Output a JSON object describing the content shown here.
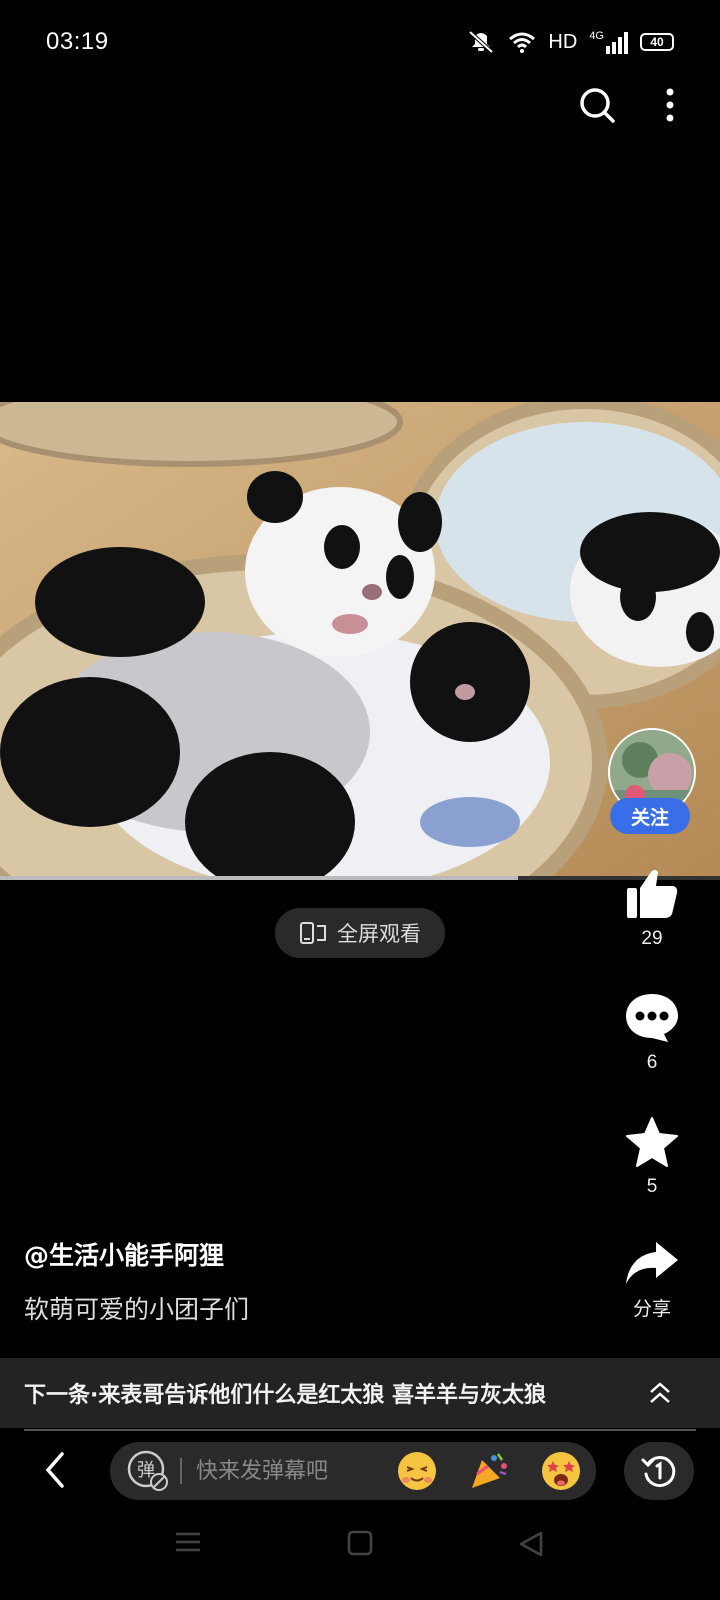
{
  "status_bar": {
    "time": "03:19",
    "network": "HD",
    "signal": "4G",
    "battery": "40"
  },
  "video": {
    "progress": 0.72
  },
  "fullscreen": {
    "label": "全屏观看"
  },
  "sidebar": {
    "follow_label": "关注",
    "like_count": "29",
    "comment_count": "6",
    "favorite_count": "5",
    "share_label": "分享"
  },
  "post": {
    "author": "@生活小能手阿狸",
    "caption": "软萌可爱的小团子们"
  },
  "next": {
    "text": "下一条·来表哥告诉他们什么是红太狼 喜羊羊与灰太狼"
  },
  "danmaku": {
    "placeholder": "快来发弹幕吧",
    "toggle_glyph": "弹"
  },
  "colors": {
    "accent": "#3a6ee8",
    "background": "#000000",
    "bar": "#232323"
  },
  "icons": [
    "search-icon",
    "more-icon",
    "like-icon",
    "comment-icon",
    "star-icon",
    "share-icon",
    "chevron-up-icon",
    "back-icon",
    "replay-icon"
  ]
}
